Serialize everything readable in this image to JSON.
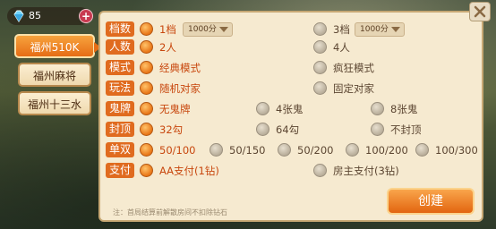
{
  "currency": {
    "amount": "85",
    "plus": "+"
  },
  "tabs": [
    {
      "label": "福州510K",
      "active": true
    },
    {
      "label": "福州麻将",
      "active": false
    },
    {
      "label": "福州十三水",
      "active": false
    }
  ],
  "rows": {
    "rounds": {
      "label": "档数",
      "opt1": "1档",
      "opt1_value": "1000分",
      "opt2": "3档",
      "opt2_value": "1000分"
    },
    "players": {
      "label": "人数",
      "opt1": "2人",
      "opt2": "4人"
    },
    "mode": {
      "label": "模式",
      "opt1": "经典模式",
      "opt2": "疯狂模式"
    },
    "play": {
      "label": "玩法",
      "opt1": "随机对家",
      "opt2": "固定对家"
    },
    "ghost": {
      "label": "鬼牌",
      "opt1": "无鬼牌",
      "opt2": "4张鬼",
      "opt3": "8张鬼"
    },
    "cap": {
      "label": "封顶",
      "opt1": "32勾",
      "opt2": "64勾",
      "opt3": "不封顶"
    },
    "stake": {
      "label": "单双",
      "opts": [
        "50/100",
        "50/150",
        "50/200",
        "100/200",
        "100/300"
      ]
    },
    "payment": {
      "label": "支付",
      "opt1": "AA支付(1钻)",
      "opt2": "房主支付(3钻)"
    }
  },
  "note": "注：首局结算前解散房间不扣除钻石",
  "create_button": "创建",
  "colors": {
    "accent": "#e06b1f",
    "panel": "#f6ead0"
  }
}
